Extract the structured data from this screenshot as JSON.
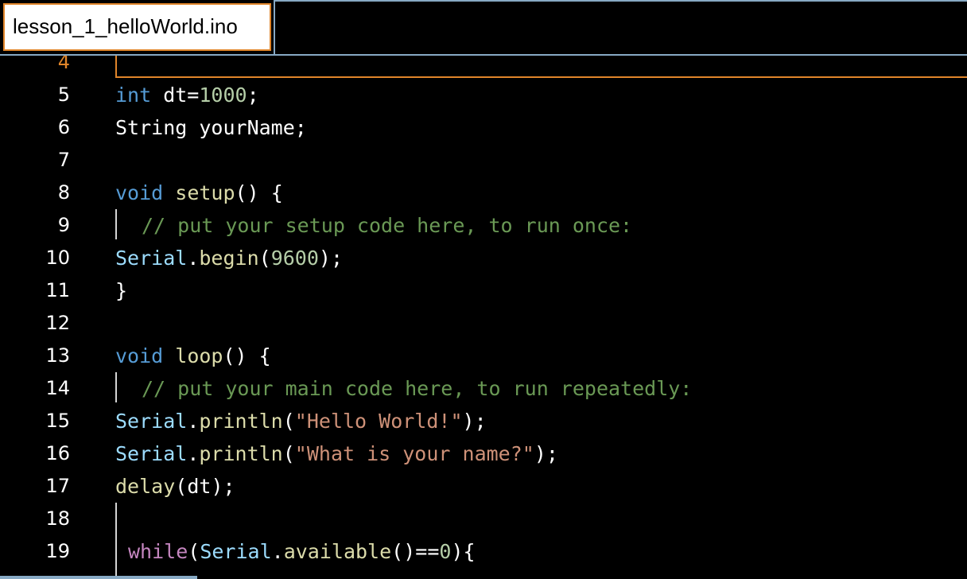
{
  "tab": {
    "filename": "lesson_1_helloWorld.ino"
  },
  "lines": [
    {
      "n": "4",
      "code": ""
    },
    {
      "n": "5",
      "code": "int dt=1000;"
    },
    {
      "n": "6",
      "code": "String yourName;"
    },
    {
      "n": "7",
      "code": ""
    },
    {
      "n": "8",
      "code": "void setup() {"
    },
    {
      "n": "9",
      "code": "// put your setup code here, to run once:"
    },
    {
      "n": "10",
      "code": "Serial.begin(9600);"
    },
    {
      "n": "11",
      "code": "}"
    },
    {
      "n": "12",
      "code": ""
    },
    {
      "n": "13",
      "code": "void loop() {"
    },
    {
      "n": "14",
      "code": "// put your main code here, to run repeatedly:"
    },
    {
      "n": "15",
      "code": "Serial.println(\"Hello World!\");"
    },
    {
      "n": "16",
      "code": "Serial.println(\"What is your name?\");"
    },
    {
      "n": "17",
      "code": "delay(dt);"
    },
    {
      "n": "18",
      "code": ""
    },
    {
      "n": "19",
      "code": "while(Serial.available()==0){"
    }
  ],
  "tokens": {
    "int": "int",
    "dt_assign": " dt=",
    "n1000": "1000",
    "semi": ";",
    "string_decl": "String yourName;",
    "void": "void",
    "setup": "setup",
    "paren_open_brace": "() {",
    "loop": "loop",
    "comment_setup": "// put your setup code here, to run once:",
    "comment_loop": "// put your main code here, to run repeatedly:",
    "serial": "Serial",
    "dot": ".",
    "begin": "begin",
    "paren_open": "(",
    "n9600": "9600",
    "paren_close_semi": ");",
    "close_brace": "}",
    "println": "println",
    "str_hello": "\"Hello World!\"",
    "str_name": "\"What is your name?\"",
    "delay": "delay",
    "dt": "dt",
    "while": "while",
    "available": "available",
    "eq_zero": "()==",
    "n0": "0",
    "close_open_brace": "){"
  },
  "colors": {
    "background": "#000000",
    "tab_border_accent": "#e0852a",
    "tab_frame": "#87a9c4",
    "keyword_type": "#569cd6",
    "keyword_control": "#c586c0",
    "function": "#dcdcaa",
    "object": "#9cdcfe",
    "number": "#b5cea8",
    "string": "#ce9178",
    "comment": "#6a9955"
  }
}
